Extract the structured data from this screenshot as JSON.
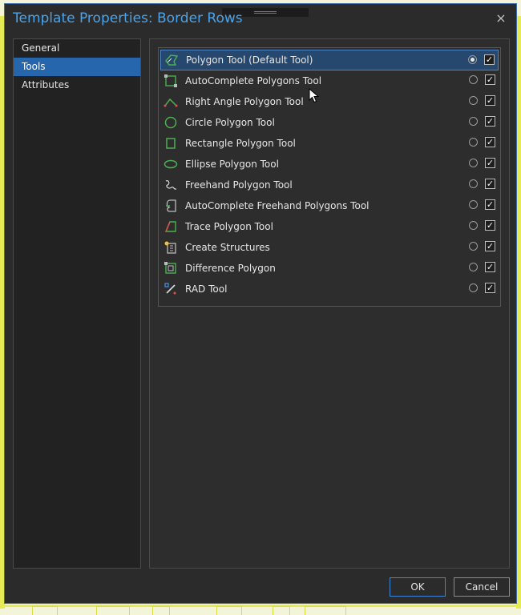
{
  "dialog": {
    "title": "Template Properties: Border Rows",
    "close_glyph": "×"
  },
  "nav": {
    "items": [
      {
        "label": "General",
        "active": false
      },
      {
        "label": "Tools",
        "active": true
      },
      {
        "label": "Attributes",
        "active": false
      }
    ]
  },
  "tools": {
    "items": [
      {
        "label": "Polygon Tool  (Default Tool)",
        "icon": "polygon-icon",
        "default": true,
        "enabled": true,
        "selected": true
      },
      {
        "label": "AutoComplete Polygons Tool",
        "icon": "autocomplete-polygon-icon",
        "default": false,
        "enabled": true
      },
      {
        "label": "Right Angle Polygon Tool",
        "icon": "right-angle-icon",
        "default": false,
        "enabled": true
      },
      {
        "label": "Circle Polygon Tool",
        "icon": "circle-icon",
        "default": false,
        "enabled": true
      },
      {
        "label": "Rectangle Polygon Tool",
        "icon": "rectangle-icon",
        "default": false,
        "enabled": true
      },
      {
        "label": "Ellipse Polygon Tool",
        "icon": "ellipse-icon",
        "default": false,
        "enabled": true
      },
      {
        "label": "Freehand Polygon Tool",
        "icon": "freehand-icon",
        "default": false,
        "enabled": true
      },
      {
        "label": "AutoComplete Freehand Polygons Tool",
        "icon": "autocomplete-freehand-icon",
        "default": false,
        "enabled": true
      },
      {
        "label": "Trace Polygon Tool",
        "icon": "trace-icon",
        "default": false,
        "enabled": true
      },
      {
        "label": "Create Structures",
        "icon": "create-structures-icon",
        "default": false,
        "enabled": true
      },
      {
        "label": "Difference Polygon",
        "icon": "difference-polygon-icon",
        "default": false,
        "enabled": true
      },
      {
        "label": "RAD Tool",
        "icon": "rad-tool-icon",
        "default": false,
        "enabled": true
      }
    ]
  },
  "buttons": {
    "ok_label": "OK",
    "cancel_label": "Cancel"
  },
  "colors": {
    "accent": "#2566ad",
    "title": "#4aa3ea",
    "icon_green": "#4caf50"
  }
}
